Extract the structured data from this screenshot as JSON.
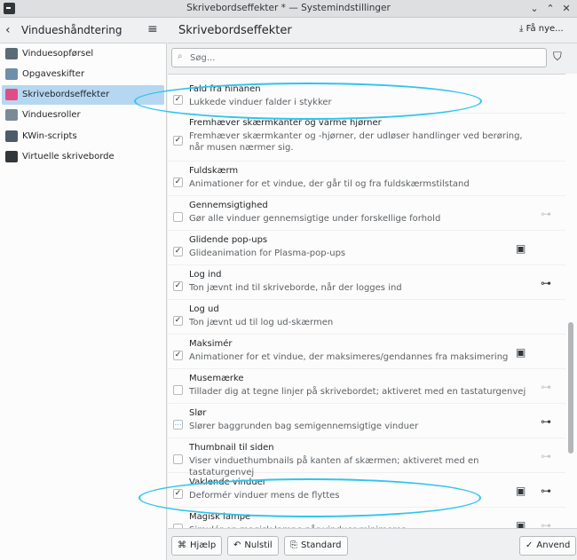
{
  "window": {
    "title": "Skrivebordseffekter * — Systemindstillinger",
    "btn_min": "⌄",
    "btn_max": "⌃",
    "btn_close": "✕"
  },
  "sidebar": {
    "back_icon": "‹",
    "title": "Vindueshåndtering",
    "menu_icon": "≡",
    "items": [
      {
        "label": "Vinduesopførsel",
        "icon": "window-icon",
        "color": "#5a6b78"
      },
      {
        "label": "Opgaveskifter",
        "icon": "taskswitcher-icon",
        "color": "#6e8fa9"
      },
      {
        "label": "Skrivebordseffekter",
        "icon": "effects-icon",
        "color": "#e04d86",
        "active": true
      },
      {
        "label": "Vinduesroller",
        "icon": "rules-icon",
        "color": "#7c8a96"
      },
      {
        "label": "KWin-scripts",
        "icon": "scripts-icon",
        "color": "#4d5c69"
      },
      {
        "label": "Virtuelle skriveborde",
        "icon": "desktops-icon",
        "color": "#31363b"
      }
    ]
  },
  "main": {
    "title": "Skrivebordseffekter",
    "get_new": "Få nye...",
    "download_icon": "⤓",
    "search_placeholder": "Søg...",
    "search_icon": "⌕",
    "filter_icon": "⛉",
    "effects": [
      {
        "title": "Fald fra hinanen",
        "desc": "Lukkede vinduer falder i stykker",
        "state": "on",
        "video": false,
        "config": "none"
      },
      {
        "title": "Fremhæver skærmkanter og varme hjørner",
        "desc": "Fremhæver skærmkanter og -hjørner, der udløser handlinger ved berøring, når musen nærmer sig.",
        "state": "on",
        "video": false,
        "config": "none"
      },
      {
        "title": "Fuldskærm",
        "desc": "Animationer for et vindue, der går til og fra fuldskærmstilstand",
        "state": "on",
        "video": false,
        "config": "none"
      },
      {
        "title": "Gennemsigtighed",
        "desc": "Gør alle vinduer gennemsigtige under forskellige forhold",
        "state": "off",
        "video": false,
        "config": "dim"
      },
      {
        "title": "Glidende pop-ups",
        "desc": "Glideanimation for Plasma-pop-ups",
        "state": "on",
        "video": true,
        "config": "none"
      },
      {
        "title": "Log ind",
        "desc": "Ton jævnt ind til skriveborde, når der logges ind",
        "state": "on",
        "video": false,
        "config": "active"
      },
      {
        "title": "Log ud",
        "desc": "Ton jævnt ud til log ud-skærmen",
        "state": "on",
        "video": false,
        "config": "none"
      },
      {
        "title": "Maksimér",
        "desc": "Animationer for et vindue, der maksimeres/gendannes fra maksimering",
        "state": "on",
        "video": true,
        "config": "none"
      },
      {
        "title": "Musemærke",
        "desc": "Tillader dig at tegne linjer på skrivebordet; aktiveret med en tastaturgenvej",
        "state": "off",
        "video": false,
        "config": "dim"
      },
      {
        "title": "Slør",
        "desc": "Slører baggrunden bag semigennemsigtige vinduer",
        "state": "partial",
        "video": false,
        "config": "active"
      },
      {
        "title": "Thumbnail til siden",
        "desc": "Viser vinduethumbnails på kanten af skærmen; aktiveret med en tastaturgenvej",
        "state": "off",
        "video": false,
        "config": "dim"
      },
      {
        "title": "Vaklende vinduer",
        "desc": "Deformér vinduer mens de flyttes",
        "state": "on",
        "video": true,
        "config": "active"
      },
      {
        "title": "Magisk lampe",
        "desc": "Simulér en magisk lampe når vinduer minimeres",
        "state": "off",
        "video": true,
        "config": "dim"
      }
    ]
  },
  "footer": {
    "help": "Hjælp",
    "reset": "Nulstil",
    "defaults": "Standard",
    "apply": "Anvend",
    "help_icon": "⌘",
    "reset_icon": "↶",
    "defaults_icon": "⎘",
    "apply_icon": "✓"
  },
  "icons": {
    "video": "▣",
    "config": "⊶"
  },
  "colors": {
    "accent": "#3daee9",
    "annotation": "#2fc4ec",
    "selection": "#b6d7f1"
  }
}
